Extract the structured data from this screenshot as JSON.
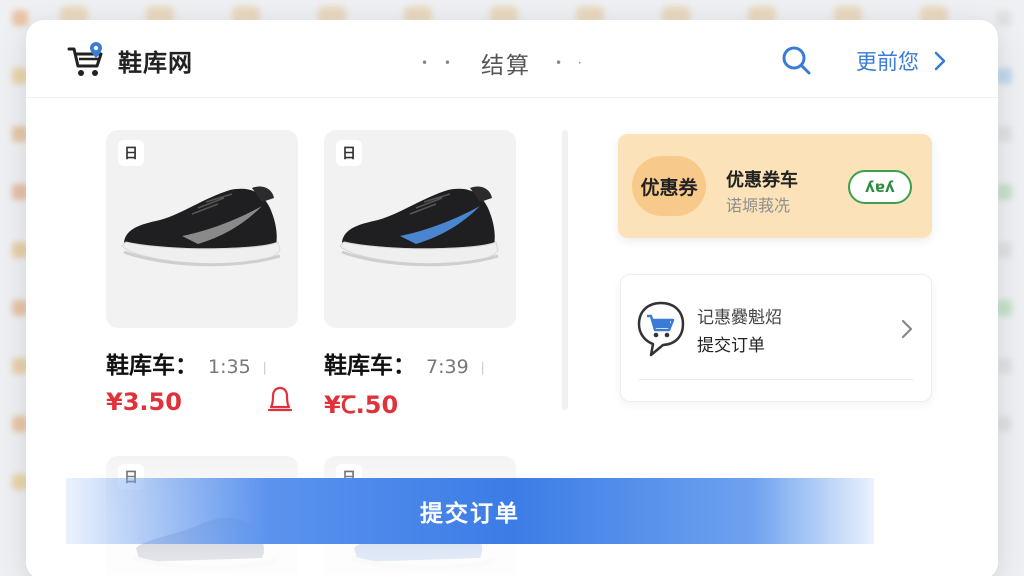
{
  "header": {
    "logo_text": "鞋库网",
    "title": "结算",
    "title_dots_left": "• •",
    "title_dots_right": "• ·",
    "more_label": "更前您"
  },
  "products": [
    {
      "badge": "日",
      "name_label": "鞋库车：",
      "time": "1:35",
      "tick": "ᛁ",
      "price": "¥3.50",
      "accent_color": "#8a8a8a"
    },
    {
      "badge": "日",
      "name_label": "鞋库车：",
      "time": "7:39",
      "tick": "ᛁ",
      "price": "¥Ꞇ.50",
      "accent_color": "#4a86d0"
    }
  ],
  "lower_products": [
    {
      "badge": "日"
    },
    {
      "badge": "日"
    }
  ],
  "coupon": {
    "badge_text": "优惠券",
    "title": "优惠券车",
    "subtitle": "诺塬莪冼",
    "button_label": "ʎɐʎ"
  },
  "order": {
    "line1": "记惠爨魁炤",
    "line2": "提交订单"
  },
  "submit": {
    "label": "提交订单"
  },
  "colors": {
    "brand_blue": "#3a7bd5",
    "price_red": "#e0323a",
    "coupon_bg": "#fbe2b8",
    "coupon_green": "#2e8b41"
  }
}
